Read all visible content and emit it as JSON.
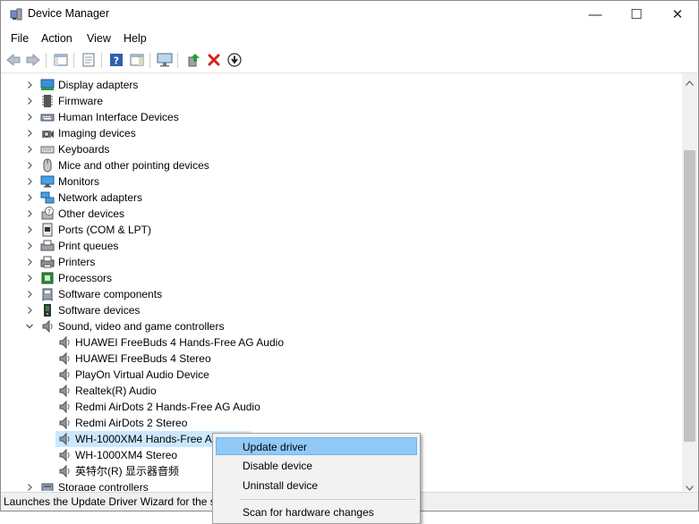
{
  "window": {
    "title": "Device Manager",
    "controls": {
      "minimize": "—",
      "maximize": "☐",
      "close": "✕"
    }
  },
  "menubar": {
    "items": [
      "File",
      "Action",
      "View",
      "Help"
    ]
  },
  "toolbar": {
    "icons": [
      "back-arrow-icon",
      "forward-arrow-icon",
      "show-hide-console-tree-icon",
      "properties-icon",
      "help-icon",
      "action-pane-icon",
      "scan-hardware-icon",
      "update-driver-icon",
      "uninstall-icon",
      "disable-device-icon"
    ]
  },
  "tree": {
    "categories": [
      {
        "label": "Display adapters",
        "icon": "display-adapter-icon",
        "expanded": false
      },
      {
        "label": "Firmware",
        "icon": "firmware-icon",
        "expanded": false
      },
      {
        "label": "Human Interface Devices",
        "icon": "hid-icon",
        "expanded": false
      },
      {
        "label": "Imaging devices",
        "icon": "camera-icon",
        "expanded": false
      },
      {
        "label": "Keyboards",
        "icon": "keyboard-icon",
        "expanded": false
      },
      {
        "label": "Mice and other pointing devices",
        "icon": "mouse-icon",
        "expanded": false
      },
      {
        "label": "Monitors",
        "icon": "monitor-icon",
        "expanded": false
      },
      {
        "label": "Network adapters",
        "icon": "network-adapter-icon",
        "expanded": false
      },
      {
        "label": "Other devices",
        "icon": "unknown-device-icon",
        "expanded": false
      },
      {
        "label": "Ports (COM & LPT)",
        "icon": "port-icon",
        "expanded": false
      },
      {
        "label": "Print queues",
        "icon": "print-queue-icon",
        "expanded": false
      },
      {
        "label": "Printers",
        "icon": "printer-icon",
        "expanded": false
      },
      {
        "label": "Processors",
        "icon": "processor-icon",
        "expanded": false
      },
      {
        "label": "Software components",
        "icon": "software-component-icon",
        "expanded": false
      },
      {
        "label": "Software devices",
        "icon": "software-device-icon",
        "expanded": false
      },
      {
        "label": "Sound, video and game controllers",
        "icon": "speaker-icon",
        "expanded": true
      }
    ],
    "sound_children": [
      "HUAWEI FreeBuds 4 Hands-Free AG Audio",
      "HUAWEI FreeBuds 4 Stereo",
      "PlayOn Virtual Audio Device",
      "Realtek(R) Audio",
      "Redmi AirDots 2 Hands-Free AG Audio",
      "Redmi AirDots 2 Stereo",
      "WH-1000XM4 Hands-Free AG",
      "WH-1000XM4 Stereo",
      "英特尔(R) 显示器音频"
    ],
    "selected_index": 6,
    "after": [
      {
        "label": "Storage controllers",
        "icon": "storage-icon",
        "expanded": false
      }
    ]
  },
  "context_menu": {
    "items": [
      "Update driver",
      "Disable device",
      "Uninstall device",
      "Scan for hardware changes"
    ],
    "highlighted_index": 0
  },
  "statusbar": {
    "text": "Launches the Update Driver Wizard for the se"
  },
  "colors": {
    "selection": "#cce8ff",
    "menu_highlight": "#91c9f7",
    "accent_blue": "#1e6fc6"
  }
}
